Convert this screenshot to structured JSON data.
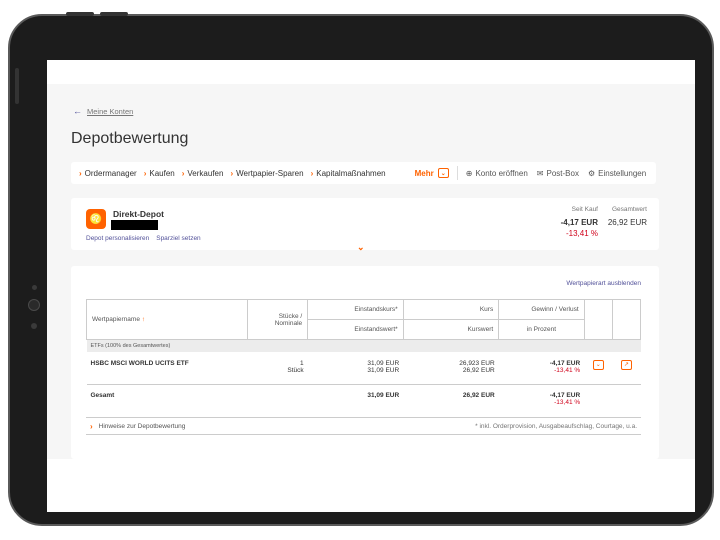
{
  "nav": {
    "back_label": "Meine Konten",
    "title": "Depotbewertung",
    "items": [
      {
        "label": "Ordermanager"
      },
      {
        "label": "Kaufen"
      },
      {
        "label": "Verkaufen"
      },
      {
        "label": "Wertpapier-Sparen"
      },
      {
        "label": "Kapitalmaßnahmen"
      }
    ],
    "mehr_label": "Mehr",
    "right_items": [
      {
        "label": "Konto eröffnen",
        "icon": "plus-circle-icon"
      },
      {
        "label": "Post-Box",
        "icon": "mail-icon"
      },
      {
        "label": "Einstellungen",
        "icon": "gear-icon"
      }
    ]
  },
  "depot": {
    "name": "Direkt-Depot",
    "link_personalize": "Depot personalisieren",
    "link_sparziel": "Sparziel setzen",
    "seit_kauf_label": "Seit Kauf",
    "seit_kauf_value": "-4,17 EUR",
    "seit_kauf_pct": "-13,41 %",
    "gesamtwert_label": "Gesamtwert",
    "gesamtwert_value": "26,92 EUR"
  },
  "table": {
    "hide_link": "Wertpapierart ausblenden",
    "headers": {
      "name": "Wertpapiername",
      "stuecke": "Stücke / Nominale",
      "einstandskurs": "Einstandskurs*",
      "einstandswert": "Einstandswert*",
      "kurs": "Kurs",
      "kurswert": "Kurswert",
      "gewinn": "Gewinn / Verlust",
      "prozent": "in Prozent"
    },
    "group_label": "ETFs (100% des Gesamtwertes)",
    "rows": [
      {
        "name": "HSBC MSCI WORLD UCITS ETF",
        "qty": "1",
        "unit": "Stück",
        "einstandskurs": "31,09 EUR",
        "einstandswert": "31,09 EUR",
        "kurs": "26,923 EUR",
        "kurswert": "26,92 EUR",
        "gv": "-4,17 EUR",
        "gv_pct": "-13,41 %"
      }
    ],
    "total": {
      "label": "Gesamt",
      "einstandswert": "31,09 EUR",
      "kurswert": "26,92 EUR",
      "gv": "-4,17 EUR",
      "gv_pct": "-13,41 %"
    },
    "footer_link": "Hinweise zur Depotbewertung",
    "footer_note": "* inkl. Orderprovision, Ausgabeaufschlag, Courtage, u.a."
  },
  "colors": {
    "accent": "#ff6200",
    "link": "#525199",
    "negative": "#d0021b"
  }
}
